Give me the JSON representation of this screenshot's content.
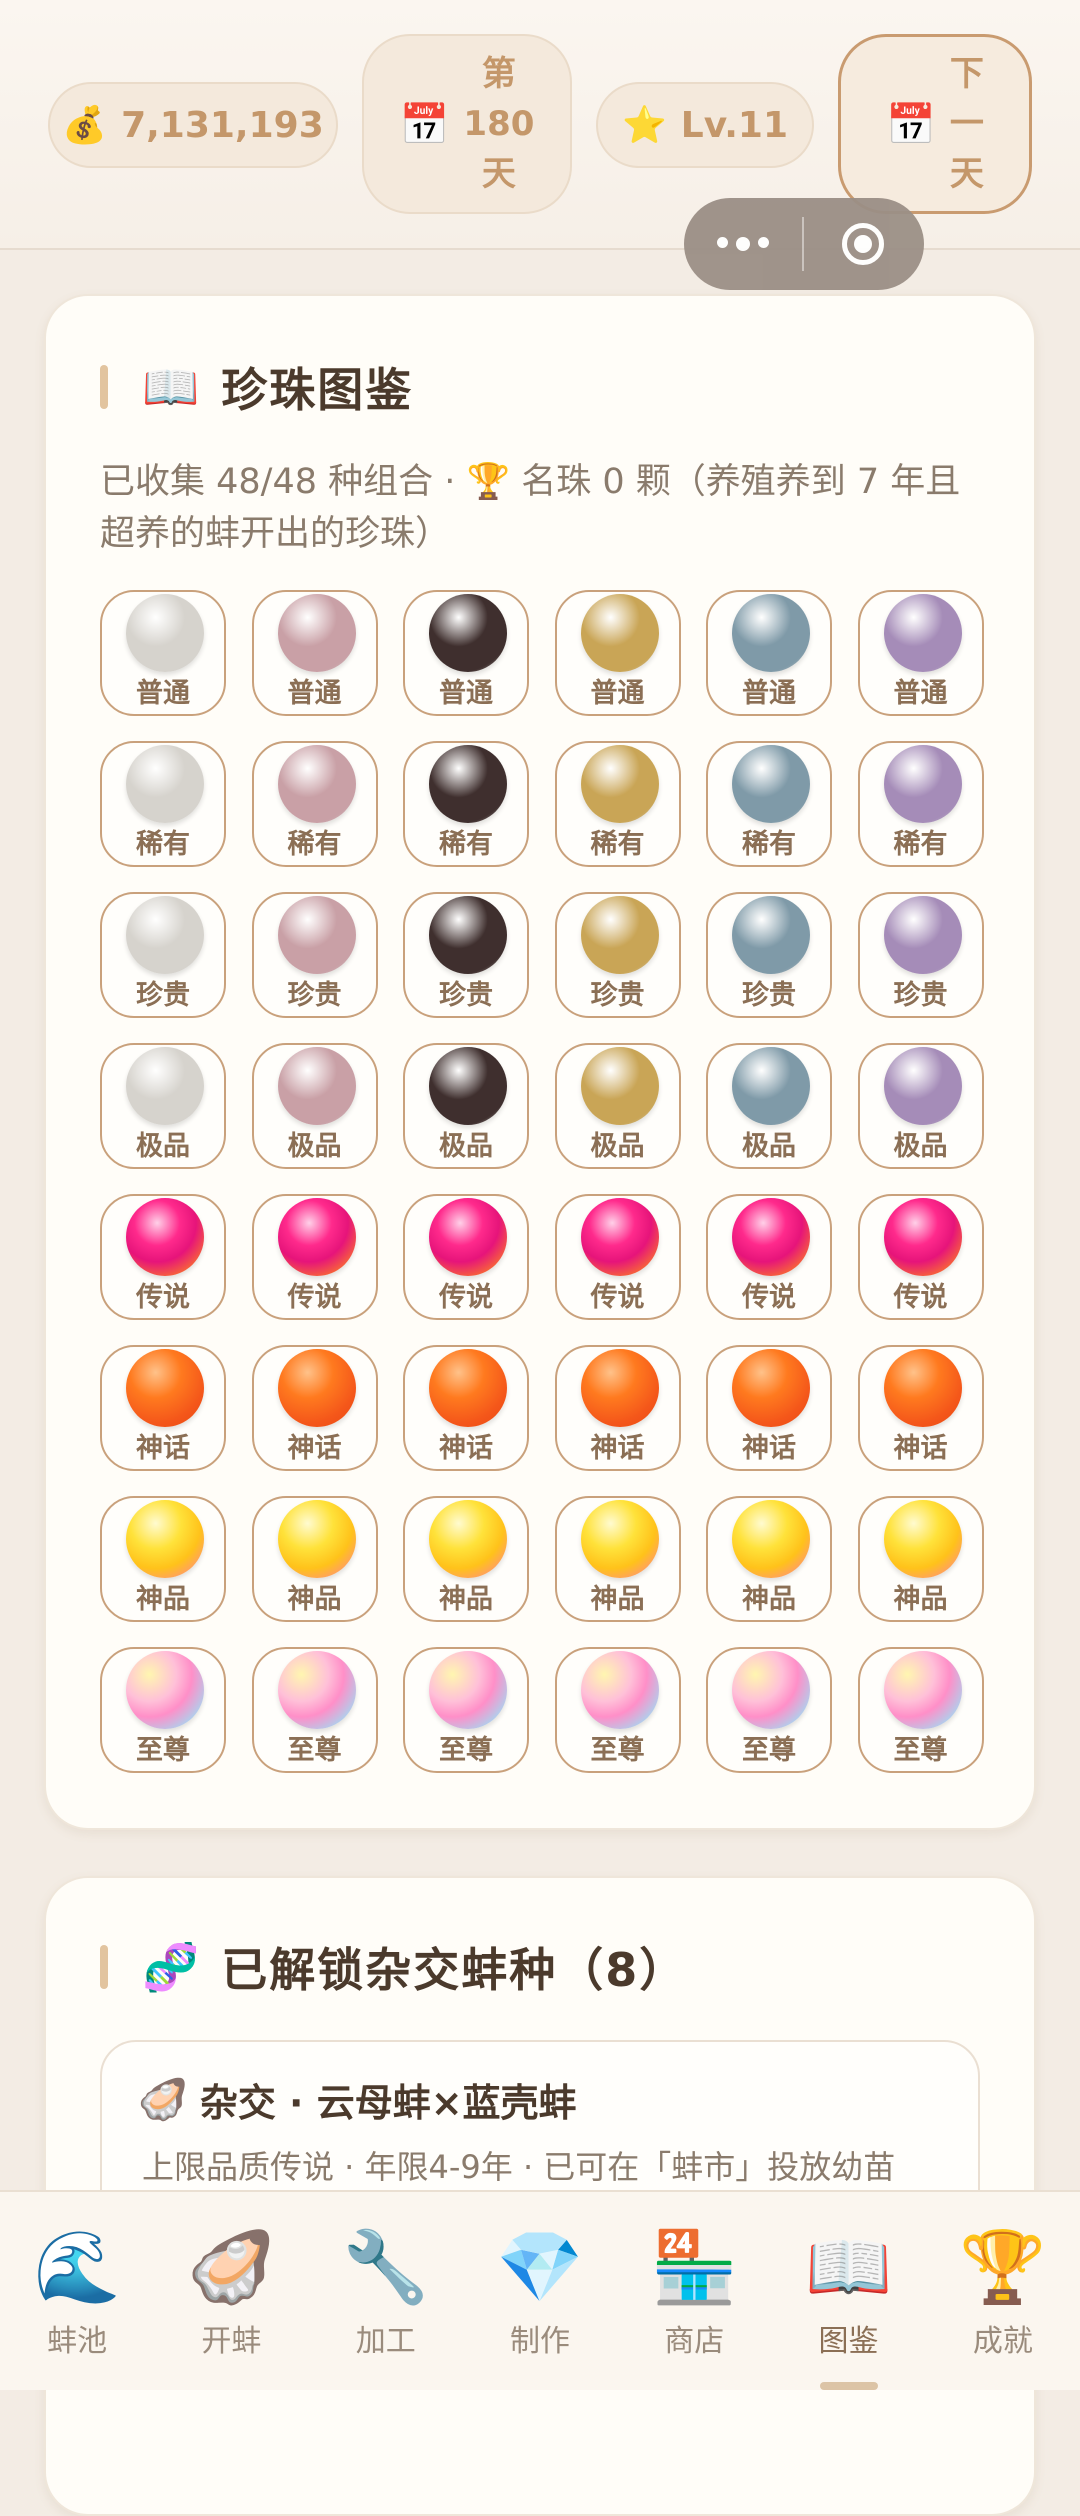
{
  "top": {
    "coins_icon": "money-bag-icon",
    "coins": "7,131,193",
    "day_icon": "calendar-icon",
    "day_lines": [
      "第",
      "180",
      "天"
    ],
    "level_icon": "star-icon",
    "level": "Lv.11",
    "next_icon": "calendar-icon",
    "next_lines": [
      "下",
      "一",
      "天"
    ]
  },
  "codex": {
    "icon": "open-book-icon",
    "title": "珍珠图鉴",
    "description": "已收集 48/48 种组合 · 🏆 名珠 0 颗（养殖养到 7 年且超养的蚌开出的珍珠）",
    "rows": [
      {
        "label": "普通",
        "kind": "plain"
      },
      {
        "label": "稀有",
        "kind": "plain"
      },
      {
        "label": "珍贵",
        "kind": "plain"
      },
      {
        "label": "极品",
        "kind": "plain"
      },
      {
        "label": "传说",
        "kind": "legend"
      },
      {
        "label": "神话",
        "kind": "myth"
      },
      {
        "label": "神品",
        "kind": "divine"
      },
      {
        "label": "至尊",
        "kind": "supreme"
      }
    ],
    "plain_colors": [
      "#d6d3cd",
      "#c9a0a6",
      "#3f2f2e",
      "#c9a556",
      "#7f9aa8",
      "#a58cb8"
    ]
  },
  "hybrids": {
    "icon": "dna-icon",
    "title": "已解锁杂交蚌种（8）",
    "items": [
      {
        "icon": "oyster-icon",
        "name": "杂交 · 云母蚌×蓝壳蚌",
        "detail": "上限品质传说 · 年限4-9年 · 已可在「蚌市」投放幼苗"
      }
    ]
  },
  "nav": [
    {
      "icon": "wave-icon",
      "glyph": "🌊",
      "label": "蚌池"
    },
    {
      "icon": "oyster-icon",
      "glyph": "🦪",
      "label": "开蚌"
    },
    {
      "icon": "wrench-icon",
      "glyph": "🔧",
      "label": "加工"
    },
    {
      "icon": "gem-icon",
      "glyph": "💎",
      "label": "制作"
    },
    {
      "icon": "store-icon",
      "glyph": "🏪",
      "label": "商店"
    },
    {
      "icon": "book-icon",
      "glyph": "📖",
      "label": "图鉴",
      "active": true
    },
    {
      "icon": "trophy-icon",
      "glyph": "🏆",
      "label": "成就"
    }
  ]
}
